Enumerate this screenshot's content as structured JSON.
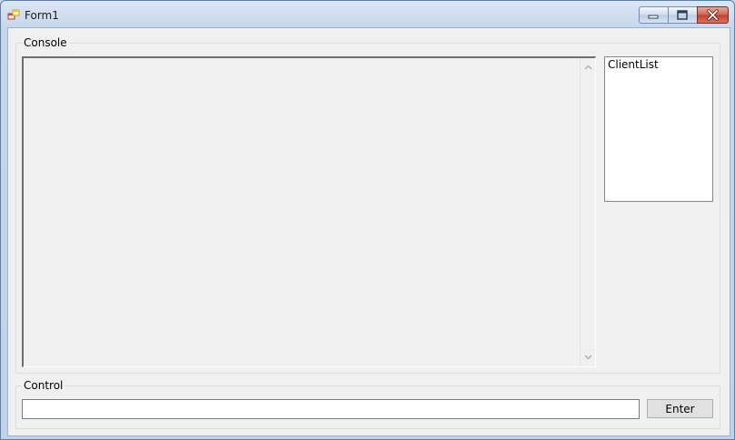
{
  "window": {
    "title": "Form1",
    "icon": "form-app-icon",
    "controls": [
      "minimize-icon",
      "maximize-icon",
      "close-icon"
    ]
  },
  "console_group": {
    "label": "Console",
    "output_text": ""
  },
  "client_list": {
    "items": [
      "ClientList"
    ]
  },
  "control_group": {
    "label": "Control",
    "input_value": "",
    "enter_label": "Enter"
  }
}
